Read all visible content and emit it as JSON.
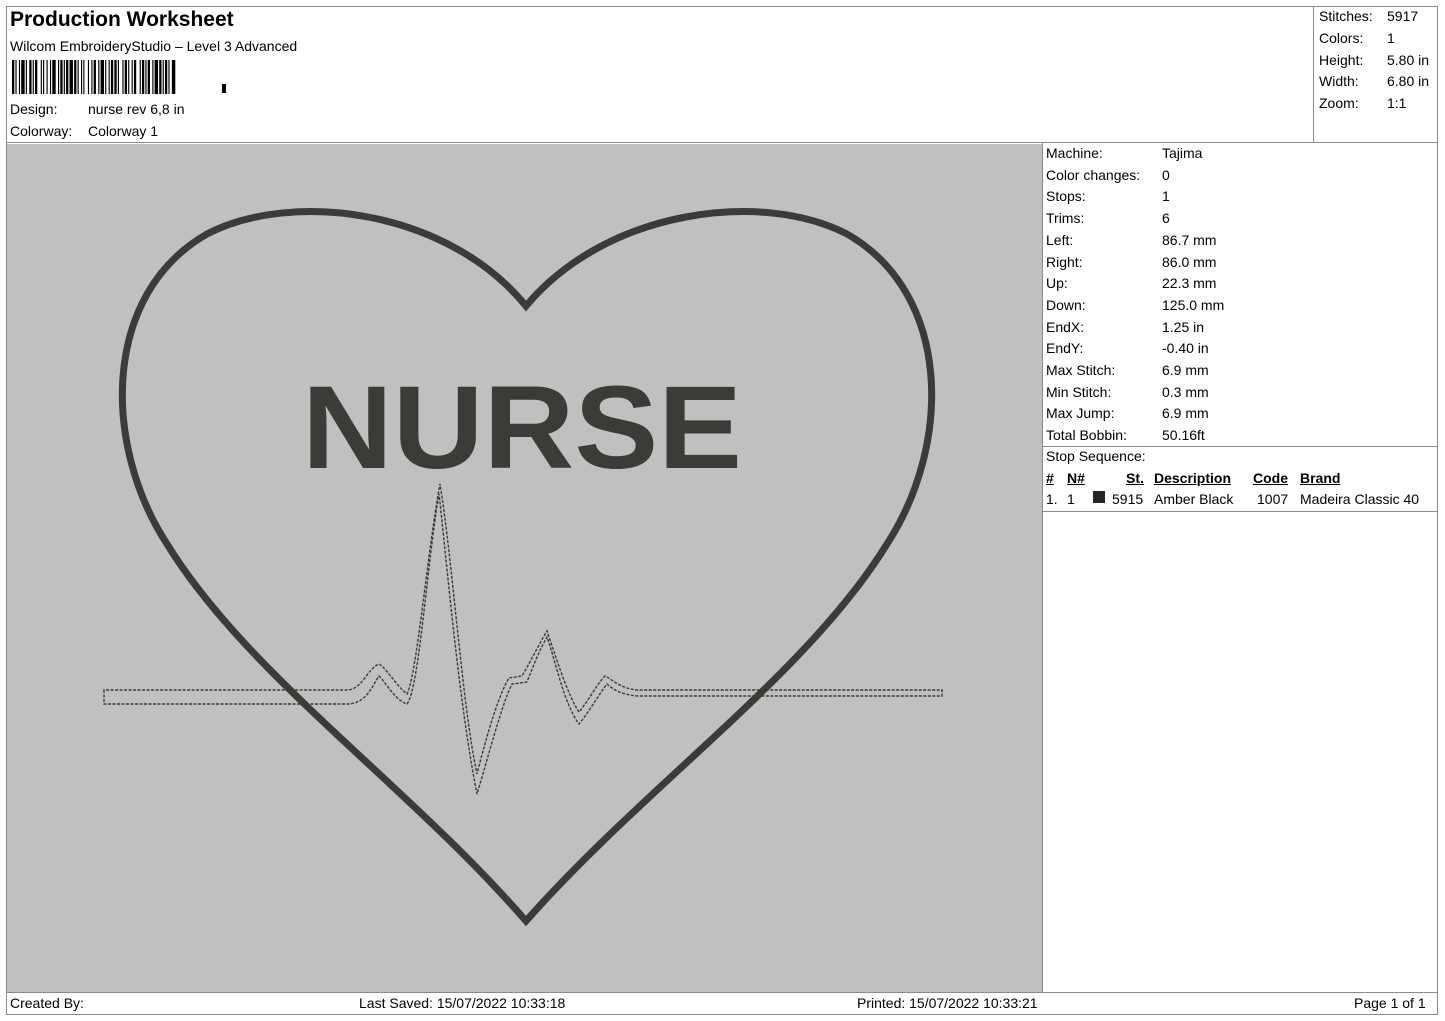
{
  "header": {
    "title": "Production Worksheet",
    "subtitle": "Wilcom EmbroideryStudio – Level 3 Advanced",
    "design_label": "Design:",
    "design_value": "nurse rev 6,8 in",
    "colorway_label": "Colorway:",
    "colorway_value": "Colorway 1"
  },
  "summary": [
    {
      "label": "Stitches:",
      "value": "5917"
    },
    {
      "label": "Colors:",
      "value": "1"
    },
    {
      "label": "Height:",
      "value": "5.80 in"
    },
    {
      "label": "Width:",
      "value": "6.80 in"
    },
    {
      "label": "Zoom:",
      "value": "1:1"
    }
  ],
  "details": [
    {
      "label": "Machine:",
      "value": "Tajima"
    },
    {
      "label": "Color changes:",
      "value": "0"
    },
    {
      "label": "Stops:",
      "value": "1"
    },
    {
      "label": "Trims:",
      "value": "6"
    },
    {
      "label": "Left:",
      "value": "86.7 mm"
    },
    {
      "label": "Right:",
      "value": "86.0 mm"
    },
    {
      "label": "Up:",
      "value": "22.3 mm"
    },
    {
      "label": "Down:",
      "value": "125.0 mm"
    },
    {
      "label": "EndX:",
      "value": "1.25 in"
    },
    {
      "label": "EndY:",
      "value": "-0.40 in"
    },
    {
      "label": "Max Stitch:",
      "value": "6.9 mm"
    },
    {
      "label": "Min Stitch:",
      "value": "0.3 mm"
    },
    {
      "label": "Max Jump:",
      "value": "6.9 mm"
    },
    {
      "label": "Total Bobbin:",
      "value": "50.16ft"
    }
  ],
  "stop_sequence": {
    "title": "Stop Sequence:",
    "headers": {
      "num": "#",
      "n": "N#",
      "st": "St.",
      "description": "Description",
      "code": "Code",
      "brand": "Brand"
    },
    "rows": [
      {
        "num": "1.",
        "n": "1",
        "swatch_color": "#262626",
        "st": "5915",
        "description": "Amber Black",
        "code": "1007",
        "brand": "Madeira Classic 40"
      }
    ]
  },
  "design_preview": {
    "text": "NURSE",
    "thread_color": "#3b3b37",
    "background_color": "#c0c0c0"
  },
  "footer": {
    "created_by": "Created By:",
    "last_saved": "Last Saved: 15/07/2022 10:33:18",
    "printed": "Printed: 15/07/2022 10:33:21",
    "page": "Page 1 of 1"
  }
}
